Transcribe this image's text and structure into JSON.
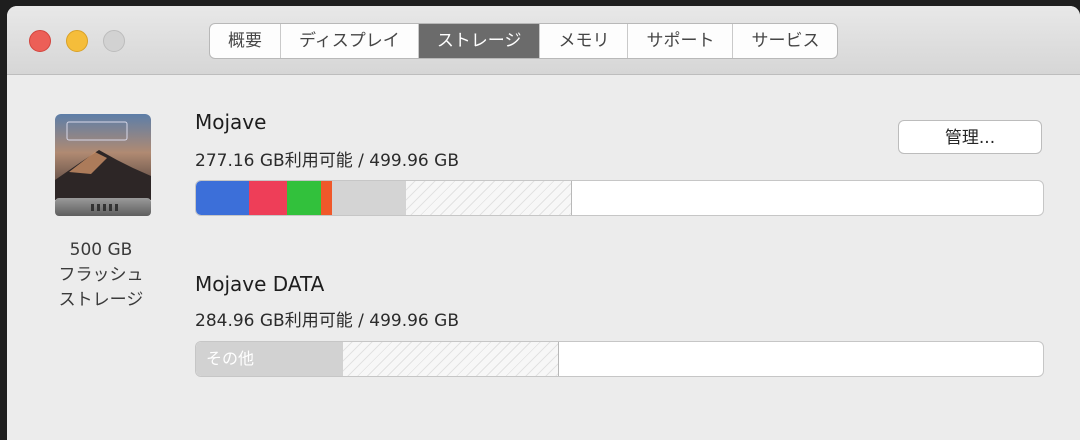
{
  "tabs": [
    {
      "label": "概要"
    },
    {
      "label": "ディスプレイ"
    },
    {
      "label": "ストレージ"
    },
    {
      "label": "メモリ"
    },
    {
      "label": "サポート"
    },
    {
      "label": "サービス"
    }
  ],
  "active_tab": "ストレージ",
  "drive": {
    "size": "500 GB",
    "type_line1": "フラッシュ",
    "type_line2": "ストレージ"
  },
  "volumes": [
    {
      "name": "Mojave",
      "usage": "277.16 GB利用可能 / 499.96 GB",
      "manage_label": "管理...",
      "usage_fractions": {
        "blue": 0.062,
        "red": 0.045,
        "green": 0.04,
        "orange": 0.014,
        "gray": 0.087,
        "hatched": 0.195
      }
    },
    {
      "name": "Mojave DATA",
      "usage": "284.96 GB利用可能 / 499.96 GB",
      "segment_label": "その他",
      "usage_fractions": {
        "other": 0.173,
        "hatched": 0.254
      }
    }
  ],
  "colors": {
    "blue": "#3c6fd9",
    "red": "#ee3e58",
    "green": "#32c13c",
    "orange": "#f0582a",
    "gray": "#d4d4d4",
    "other": "#d2d2d2",
    "close": "#ec5f57",
    "minimize": "#f5bd3a",
    "maximize": "#d2d2d2"
  }
}
